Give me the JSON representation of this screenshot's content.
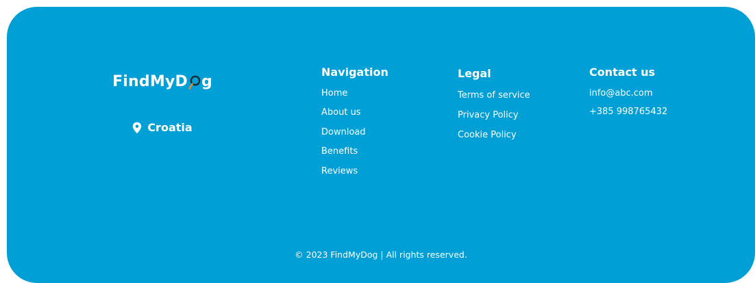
{
  "brand": {
    "logo_prefix": "FindMyD",
    "logo_suffix": "g",
    "location": "Croatia"
  },
  "navigation": {
    "heading": "Navigation",
    "items": [
      "Home",
      "About us",
      "Download",
      "Benefits",
      "Reviews"
    ]
  },
  "legal": {
    "heading": "Legal",
    "items": [
      "Terms of service",
      "Privacy Policy",
      "Cookie Policy"
    ]
  },
  "contact": {
    "heading": "Contact us",
    "email": "info@abc.com",
    "phone": "+385 998765432"
  },
  "copyright": "© 2023 FindMyDog | All rights reserved.",
  "colors": {
    "footer_bg": "#00a0d6",
    "text": "#ffffff",
    "magnifier_handle": "#d98a3a",
    "magnifier_ring": "#1b2a33"
  },
  "icons": {
    "logo_o": "magnifier-icon",
    "location": "location-pin-icon"
  }
}
